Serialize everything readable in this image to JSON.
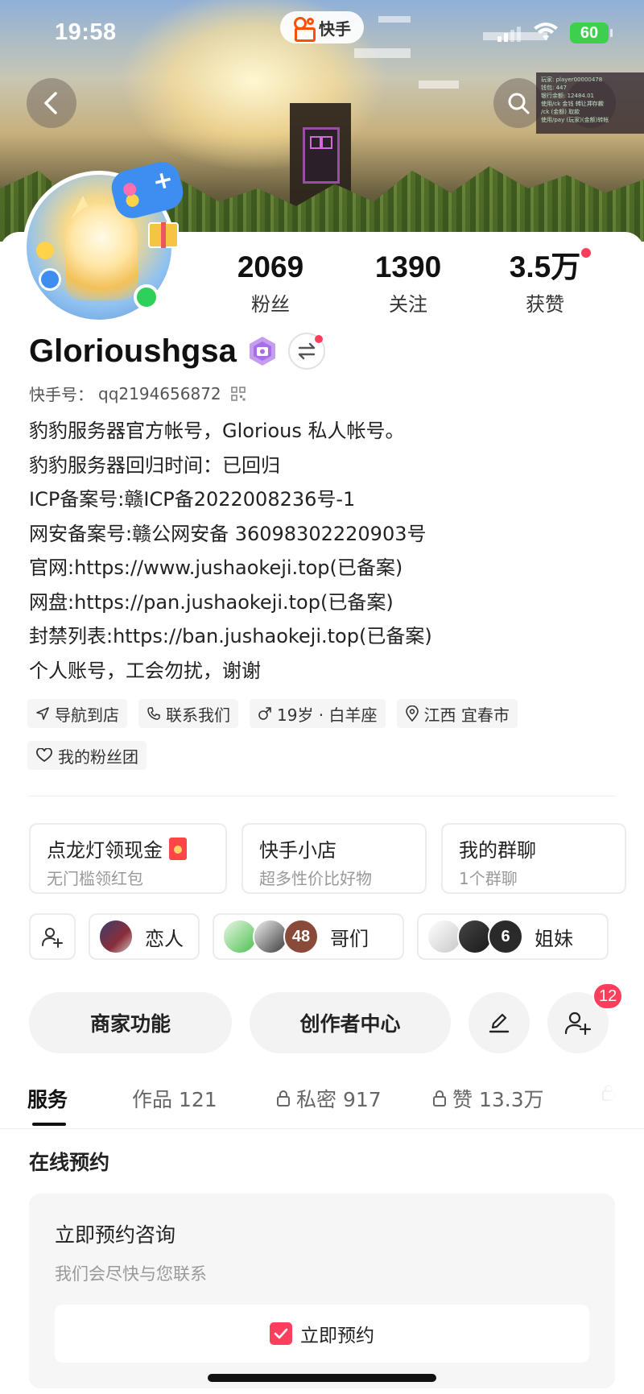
{
  "status_bar": {
    "time": "19:58",
    "app_name": "快手",
    "battery": "60"
  },
  "overlay_note_lines": [
    "玩家: player00000478",
    "钱包: 447",
    "银行余额: 12484.01",
    "使用/ck 金钱 转让并存款",
    "/ck (金额) 取款",
    "使用/pay (玩家)(金额)转帐"
  ],
  "profile": {
    "username": "Glorioushgsa",
    "kuaishou_id_label": "快手号：",
    "kuaishou_id": "qq2194656872",
    "stats": [
      {
        "value": "2069",
        "label": "粉丝"
      },
      {
        "value": "1390",
        "label": "关注"
      },
      {
        "value": "3.5万",
        "label": "获赞"
      }
    ],
    "bio": [
      "豹豹服务器官方帐号，Glorious 私人帐号。",
      "豹豹服务器回归时间：已回归",
      "ICP备案号:赣ICP备2022008236号-1",
      "网安备案号:赣公网安备 36098302220903号",
      "官网:https://www.jushaokeji.top(已备案)",
      "网盘:https://pan.jushaokeji.top(已备案)",
      "封禁列表:https://ban.jushaokeji.top(已备案)",
      "个人账号，工会勿扰，谢谢"
    ],
    "tags": [
      {
        "icon": "navigation-icon",
        "label": "导航到店"
      },
      {
        "icon": "phone-icon",
        "label": "联系我们"
      },
      {
        "icon": "male-icon",
        "label": "19岁 · 白羊座"
      },
      {
        "icon": "location-pin-icon",
        "label": "江西 宜春市"
      },
      {
        "icon": "heart-outline-icon",
        "label": "我的粉丝团"
      }
    ]
  },
  "features": [
    {
      "title": "点龙灯领现金",
      "subtitle": "无门槛领红包"
    },
    {
      "title": "快手小店",
      "subtitle": "超多性价比好物"
    },
    {
      "title": "我的群聊",
      "subtitle": "1个群聊"
    }
  ],
  "groups": [
    {
      "label": "恋人"
    },
    {
      "label": "哥们",
      "count": "48"
    },
    {
      "label": "姐妹",
      "count": "6"
    }
  ],
  "actions": {
    "merchant": "商家功能",
    "creator": "创作者中心",
    "add_friend_badge": "12"
  },
  "tabs": [
    {
      "label": "服务",
      "active": true
    },
    {
      "label": "作品 121"
    },
    {
      "label": "私密 917",
      "locked": true
    },
    {
      "label": "赞 13.3万",
      "locked": true
    }
  ],
  "booking": {
    "section_title": "在线预约",
    "title": "立即预约咨询",
    "subtitle": "我们会尽快与您联系",
    "button": "立即预约"
  },
  "colors": {
    "accent_red": "#ff3d5c",
    "online_green": "#2ecf5a",
    "kuaishou_orange": "#ff5000"
  }
}
